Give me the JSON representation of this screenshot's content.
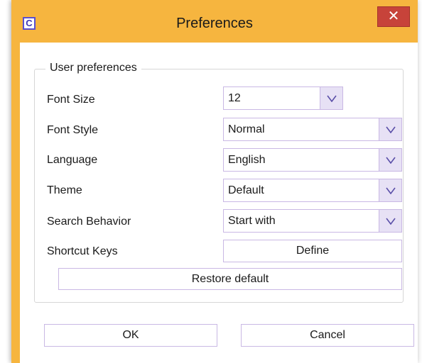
{
  "window": {
    "title": "Preferences",
    "app_icon_glyph": "C",
    "close_glyph": "✕"
  },
  "group": {
    "legend": "User preferences"
  },
  "fields": {
    "font_size": {
      "label": "Font Size",
      "value": "12"
    },
    "font_style": {
      "label": "Font Style",
      "value": "Normal"
    },
    "language": {
      "label": "Language",
      "value": "English"
    },
    "theme": {
      "label": "Theme",
      "value": "Default"
    },
    "search_behavior": {
      "label": "Search Behavior",
      "value": "Start with"
    },
    "shortcut_keys": {
      "label": "Shortcut Keys",
      "button": "Define"
    }
  },
  "buttons": {
    "restore_default": "Restore default",
    "ok": "OK",
    "cancel": "Cancel"
  },
  "colors": {
    "frame": "#f6b53f",
    "close": "#c7433a",
    "control_border": "#c9b8e4",
    "arrow_bg": "#e7e1f5",
    "icon_accent": "#5a4fd0"
  },
  "icons": {
    "app": "app-icon",
    "close": "close-icon",
    "dropdown": "chevron-down-icon"
  }
}
